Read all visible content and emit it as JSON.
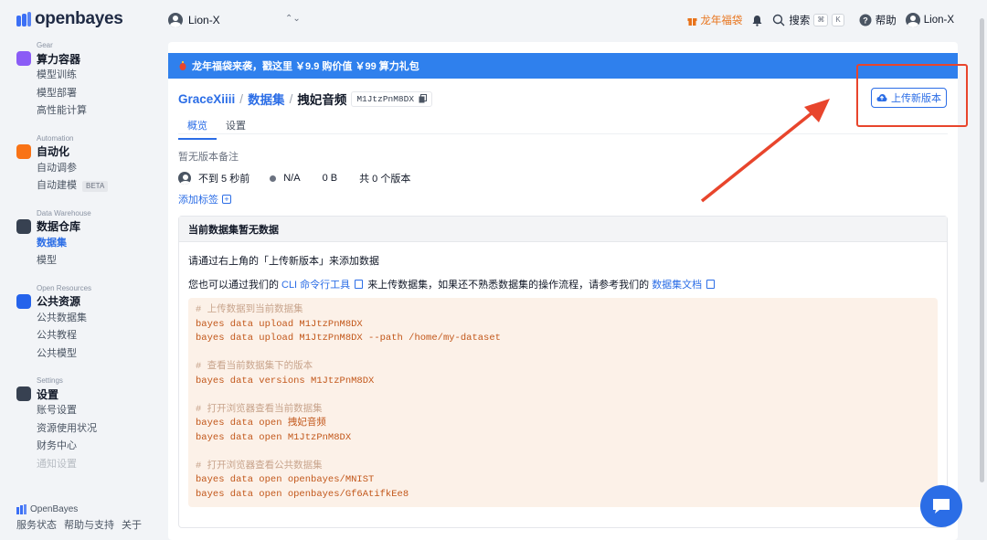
{
  "brand": {
    "name": "openbayes"
  },
  "sidebar": {
    "groups": [
      {
        "en": "Gear",
        "title": "算力容器",
        "color": "#8b5cf6",
        "items": [
          {
            "label": "模型训练"
          },
          {
            "label": "模型部署"
          },
          {
            "label": "高性能计算"
          }
        ]
      },
      {
        "en": "Automation",
        "title": "自动化",
        "color": "#f97316",
        "items": [
          {
            "label": "自动调参"
          },
          {
            "label": "自动建模",
            "badge": "BETA"
          }
        ]
      },
      {
        "en": "Data Warehouse",
        "title": "数据仓库",
        "color": "#374151",
        "items": [
          {
            "label": "数据集",
            "active": true
          },
          {
            "label": "模型"
          }
        ]
      },
      {
        "en": "Open Resources",
        "title": "公共资源",
        "color": "#2563eb",
        "items": [
          {
            "label": "公共数据集"
          },
          {
            "label": "公共教程"
          },
          {
            "label": "公共模型"
          }
        ]
      },
      {
        "en": "Settings",
        "title": "设置",
        "color": "#374151",
        "items": [
          {
            "label": "账号设置"
          },
          {
            "label": "资源使用状况"
          },
          {
            "label": "财务中心"
          },
          {
            "label": "通知设置"
          }
        ]
      }
    ],
    "footer": {
      "brand": "OpenBayes",
      "links": [
        "服务状态",
        "帮助与支持",
        "关于"
      ]
    }
  },
  "topbar": {
    "org_name": "Lion-X",
    "promo": "龙年福袋",
    "search_label": "搜索",
    "kbd1": "⌘",
    "kbd2": "K",
    "help_label": "帮助",
    "user_name": "Lion-X"
  },
  "banner": {
    "text": "龙年福袋来袭，戳这里 ￥9.9 购价值 ￥99 算力礼包"
  },
  "breadcrumb": {
    "owner": "GraceXiiii",
    "section": "数据集",
    "current": "拽妃音频",
    "id": "M1JtzPnM8DX"
  },
  "upload_button": "上传新版本",
  "tabs": [
    {
      "label": "概览",
      "active": true
    },
    {
      "label": "设置"
    }
  ],
  "version_note": "暂无版本备注",
  "meta": {
    "time": "不到 5 秒前",
    "status": "N/A",
    "size": "0 B",
    "versions": "共 0 个版本"
  },
  "add_tag": "添加标签",
  "panel": {
    "title": "当前数据集暂无数据",
    "line1": "请通过右上角的「上传新版本」来添加数据",
    "line2_prefix": "您也可以通过我们的",
    "cli_link": "CLI 命令行工具",
    "line2_mid": "来上传数据集，如果还不熟悉数据集的操作流程，请参考我们的",
    "doc_link": "数据集文档"
  },
  "code_lines": [
    {
      "text": "# 上传数据到当前数据集",
      "comment": true
    },
    {
      "text": "bayes data upload M1JtzPnM8DX"
    },
    {
      "text": "bayes data upload M1JtzPnM8DX --path /home/my-dataset"
    },
    {
      "text": ""
    },
    {
      "text": "# 查看当前数据集下的版本",
      "comment": true
    },
    {
      "text": "bayes data versions M1JtzPnM8DX"
    },
    {
      "text": ""
    },
    {
      "text": "# 打开浏览器查看当前数据集",
      "comment": true
    },
    {
      "text": "bayes data open 拽妃音频"
    },
    {
      "text": "bayes data open M1JtzPnM8DX"
    },
    {
      "text": ""
    },
    {
      "text": "# 打开浏览器查看公共数据集",
      "comment": true
    },
    {
      "text": "bayes data open openbayes/MNIST"
    },
    {
      "text": "bayes data open openbayes/Gf6AtifkEe8"
    }
  ],
  "colors": {
    "accent": "#2b6de6",
    "banner": "#2f80ed",
    "annotation": "#e8452c",
    "promo": "#e8731b"
  }
}
